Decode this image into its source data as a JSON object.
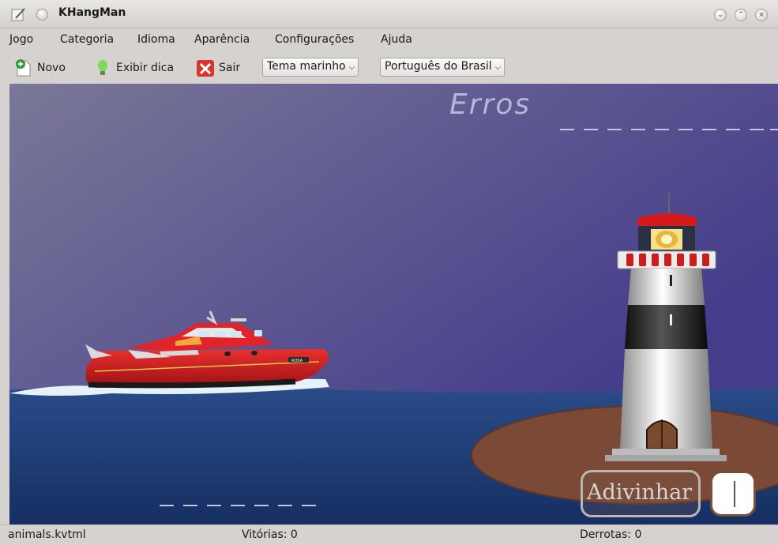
{
  "window": {
    "title": "KHangMan"
  },
  "menu": {
    "items": [
      "Jogo",
      "Categoria",
      "Idioma",
      "Aparência",
      "Configurações",
      "Ajuda"
    ]
  },
  "toolbar": {
    "new_label": "Novo",
    "hint_label": "Exibir dica",
    "quit_label": "Sair",
    "theme_value": "Tema marinho",
    "language_value": "Português do Brasil"
  },
  "game": {
    "errors_label": "Erros",
    "boat_name": "ROSA",
    "guess_button_label": "Adivinhar",
    "word_letters": 7
  },
  "status": {
    "file": "animals.kvtml",
    "wins": "Vitórias: 0",
    "losses": "Derrotas: 0"
  },
  "colors": {
    "sky_top": "#757296",
    "sky_bottom": "#453f8a",
    "sea": "#1f3c74",
    "island": "#7a4a36",
    "boat_red": "#d8262a"
  }
}
